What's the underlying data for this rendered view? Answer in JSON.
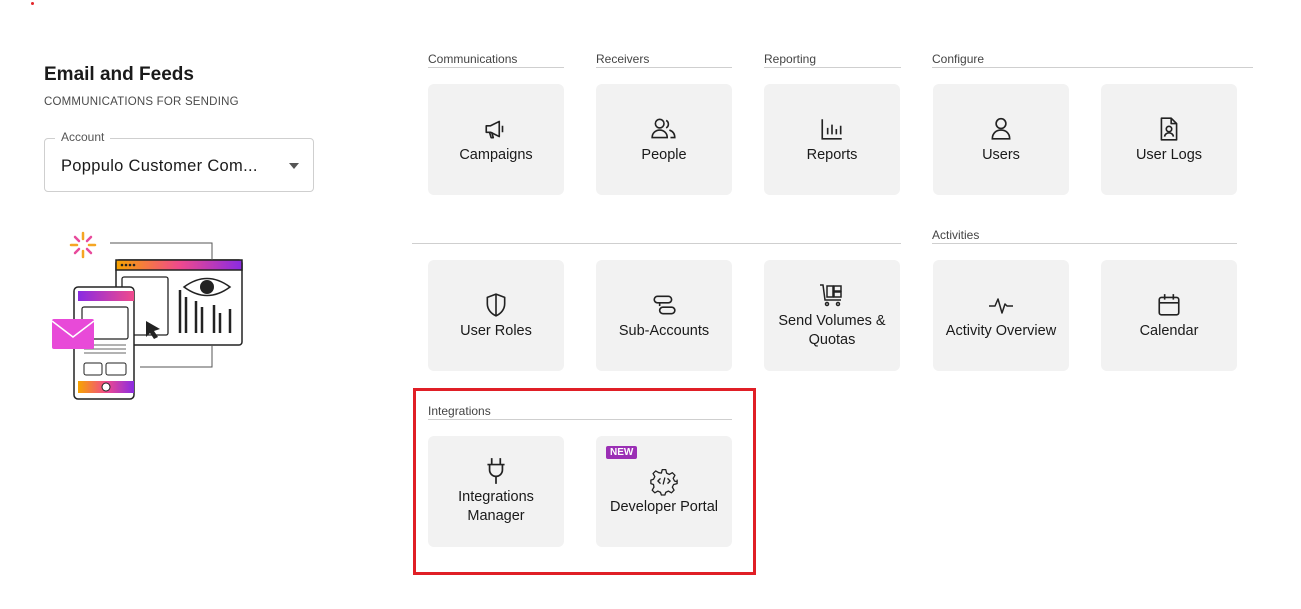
{
  "header": {
    "title": "Email and Feeds",
    "subtitle": "COMMUNICATIONS FOR SENDING"
  },
  "account": {
    "label": "Account",
    "value": "Poppulo Customer Com..."
  },
  "sections": {
    "communications": "Communications",
    "receivers": "Receivers",
    "reporting": "Reporting",
    "configure": "Configure",
    "activities": "Activities",
    "integrations": "Integrations"
  },
  "tiles": {
    "campaigns": "Campaigns",
    "people": "People",
    "reports": "Reports",
    "users": "Users",
    "user_logs": "User Logs",
    "user_roles": "User Roles",
    "sub_accounts": "Sub-Accounts",
    "send_volumes_line1": "Send Volumes &",
    "send_volumes_line2": "Quotas",
    "activity_overview": "Activity Overview",
    "calendar": "Calendar",
    "integrations_manager_line1": "Integrations",
    "integrations_manager_line2": "Manager",
    "developer_portal": "Developer Portal",
    "new_badge": "NEW"
  },
  "colors": {
    "tile_bg": "#f2f2f2",
    "highlight": "#e01f26",
    "badge": "#9b2fb5"
  }
}
